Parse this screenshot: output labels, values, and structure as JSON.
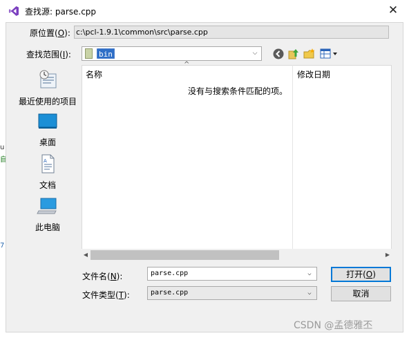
{
  "window": {
    "title": "查找源: parse.cpp",
    "close_glyph": "✕"
  },
  "location": {
    "label_prefix": "原位置(",
    "label_key": "O",
    "label_suffix": "):",
    "value": "c:\\pcl-1.9.1\\common\\src\\parse.cpp"
  },
  "lookin": {
    "label_prefix": "查找范围(",
    "label_key": "I",
    "label_suffix": "):",
    "value": "bin"
  },
  "places": [
    {
      "label": "最近使用的项目",
      "icon": "recent-items-icon"
    },
    {
      "label": "桌面",
      "icon": "desktop-icon"
    },
    {
      "label": "文档",
      "icon": "documents-icon"
    },
    {
      "label": "此电脑",
      "icon": "this-pc-icon"
    }
  ],
  "filelist": {
    "columns": {
      "name": "名称",
      "modified": "修改日期"
    },
    "sort_glyph": "^",
    "empty_message": "没有与搜索条件匹配的项。"
  },
  "filename": {
    "label_prefix": "文件名(",
    "label_key": "N",
    "label_suffix": "):",
    "value": "parse.cpp"
  },
  "filetype": {
    "label_prefix": "文件类型(",
    "label_key": "T",
    "label_suffix": "):",
    "value": "parse.cpp"
  },
  "buttons": {
    "open_prefix": "打开(",
    "open_key": "O",
    "open_suffix": ")",
    "cancel": "取消"
  },
  "watermark": "CSDN @孟德雅丕",
  "background_fragments": [
    "u",
    "自",
    "7"
  ],
  "colors": {
    "selection": "#2f6fc7",
    "default_button_border": "#0078d7",
    "dialog_bg": "#f0f0f0"
  }
}
